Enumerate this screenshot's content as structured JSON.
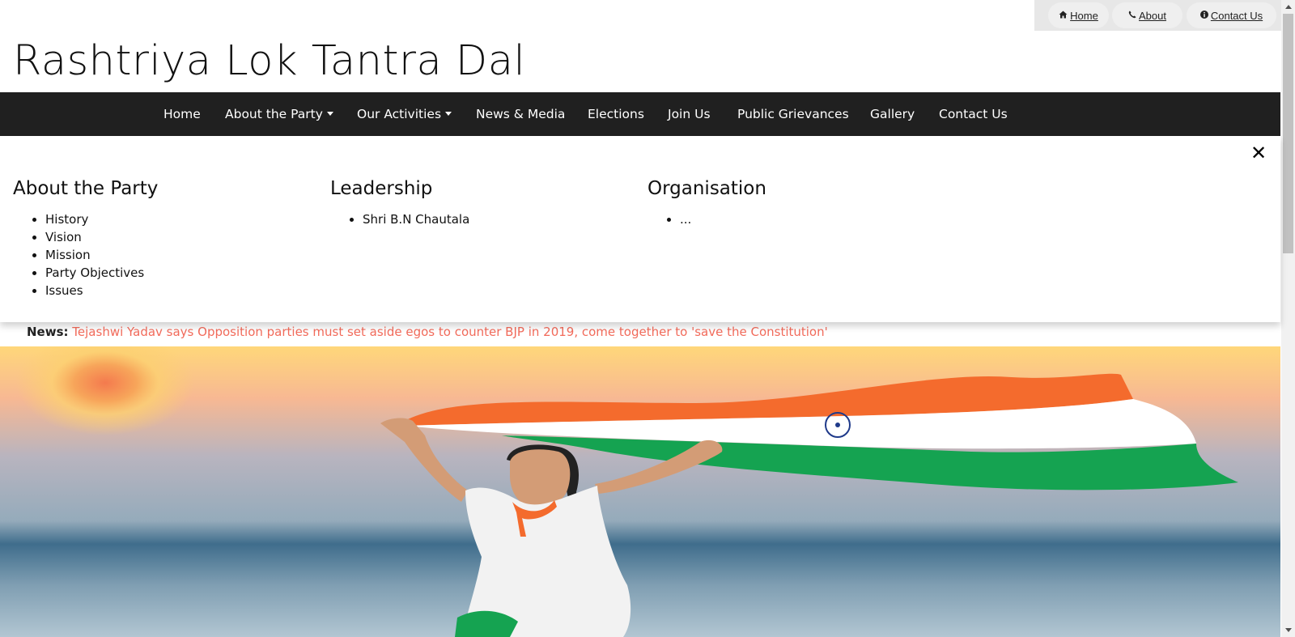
{
  "top_links": {
    "home": {
      "icon": "home-icon",
      "label": "Home"
    },
    "about": {
      "icon": "phone-icon",
      "label": "About"
    },
    "contact": {
      "icon": "info-circle-icon",
      "label": "Contact Us"
    }
  },
  "site": {
    "title": "Rashtriya Lok Tantra Dal"
  },
  "nav": {
    "items": [
      {
        "label": "Home",
        "has_caret": false
      },
      {
        "label": "About the Party",
        "has_caret": true
      },
      {
        "label": "Our Activities",
        "has_caret": true
      },
      {
        "label": "News & Media",
        "has_caret": false
      },
      {
        "label": "Elections",
        "has_caret": false
      },
      {
        "label": "Join Us",
        "has_caret": false
      },
      {
        "label": "Public Grievances",
        "has_caret": false
      },
      {
        "label": "Gallery",
        "has_caret": false
      },
      {
        "label": "Contact Us",
        "has_caret": false
      }
    ]
  },
  "mega_menu": {
    "close_icon": "close-icon",
    "close_glyph": "✕",
    "columns": [
      {
        "heading": "About the Party",
        "links": [
          "History",
          "Vision",
          "Mission",
          "Party Objectives",
          "Issues"
        ]
      },
      {
        "heading": "Leadership",
        "links": [
          "Shri B.N Chautala"
        ]
      },
      {
        "heading": "Organisation",
        "links": [
          "..."
        ]
      }
    ]
  },
  "news": {
    "label": "News:",
    "headline": "Tejashwi Yadav says Opposition parties must set aside egos to counter BJP in 2019, come together to 'save the Constitution'"
  },
  "colors": {
    "nav_bg": "#202020",
    "headline": "#f26b5b",
    "saffron": "#f46b2d",
    "green": "#15a351",
    "chakra": "#1f3a8a"
  }
}
